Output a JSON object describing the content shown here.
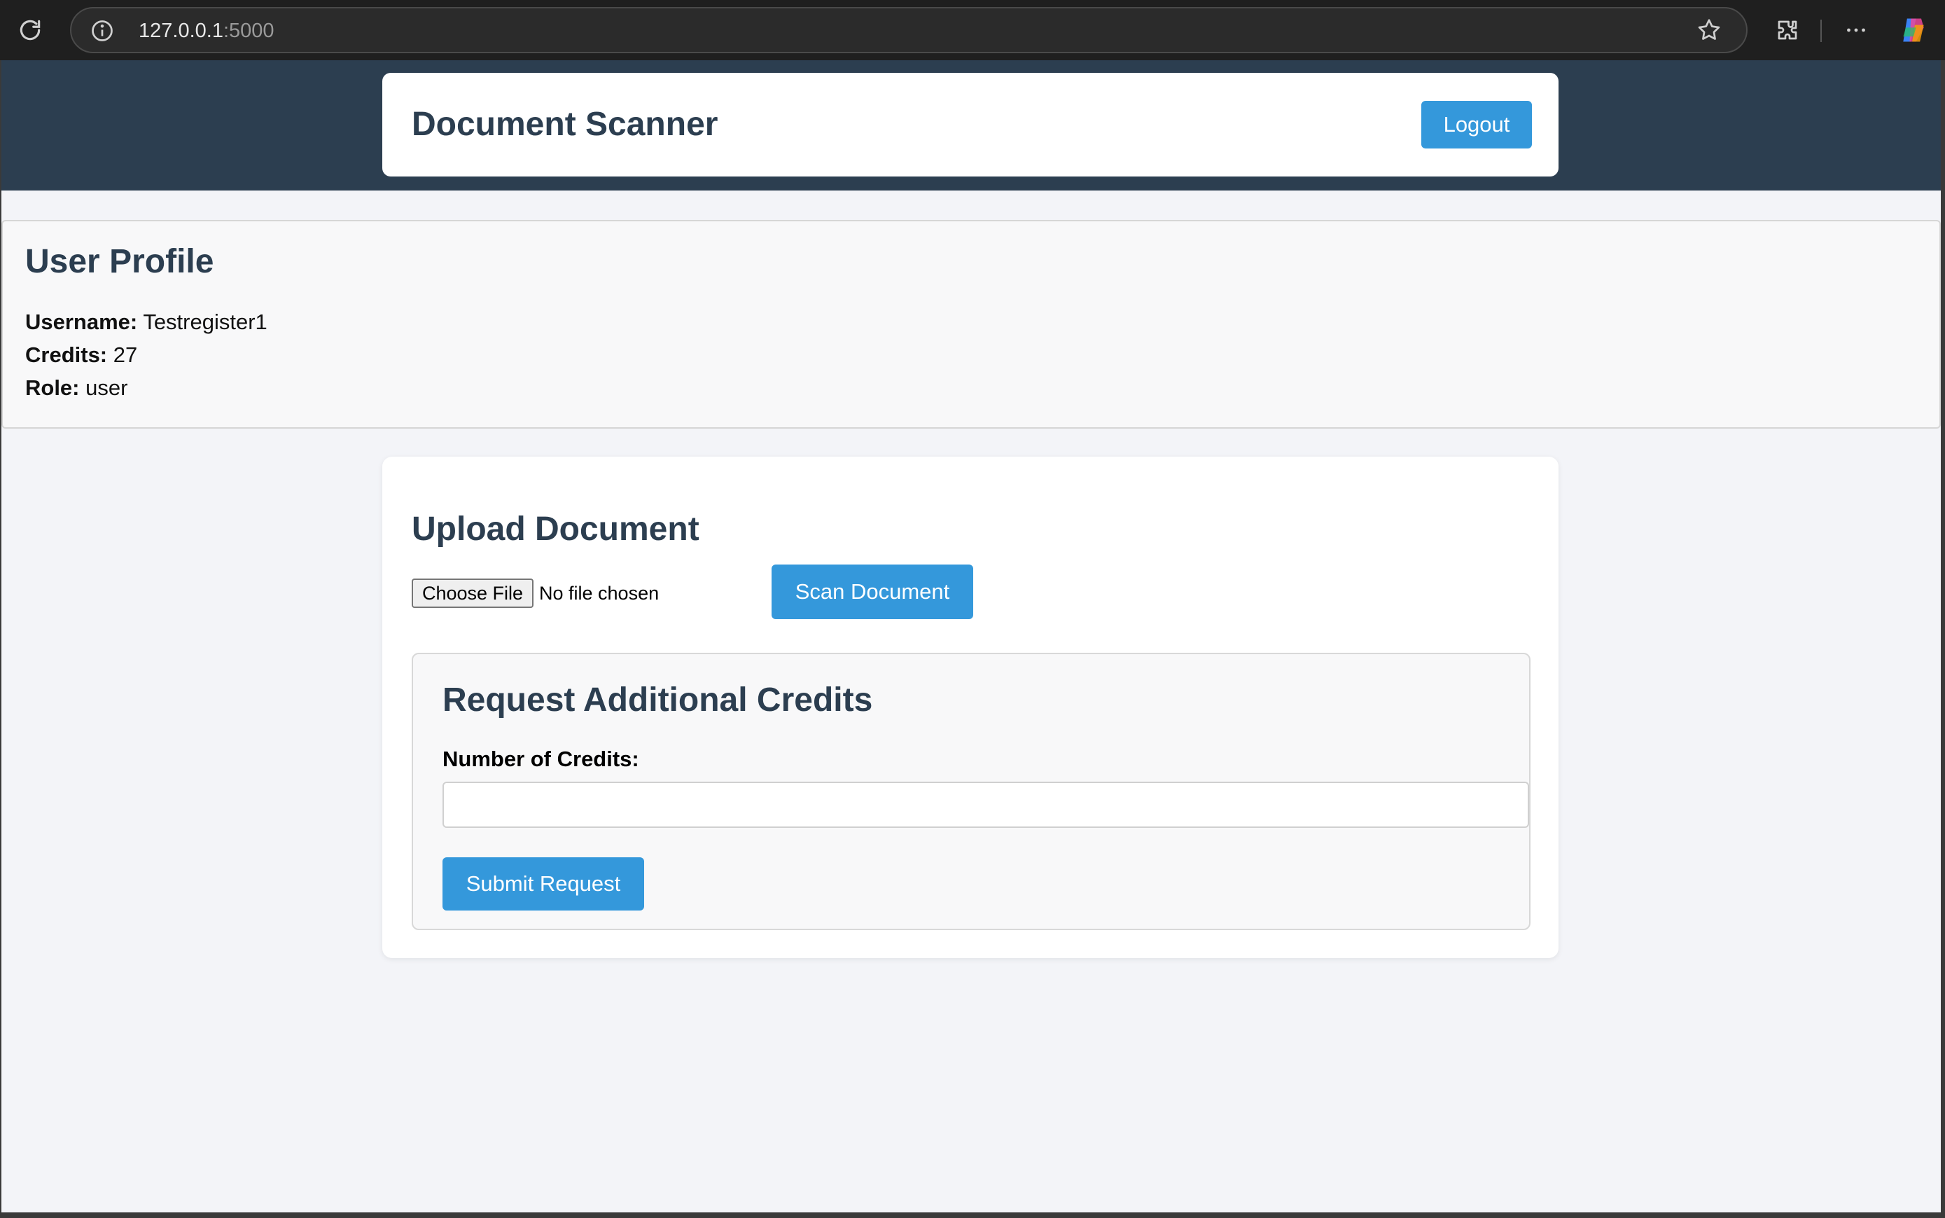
{
  "browser": {
    "url_host": "127.0.0.1",
    "url_port": ":5000"
  },
  "header": {
    "title": "Document Scanner",
    "logout_label": "Logout"
  },
  "profile": {
    "title": "User Profile",
    "username_label": "Username:",
    "username_value": "Testregister1",
    "credits_label": "Credits:",
    "credits_value": "27",
    "role_label": "Role:",
    "role_value": "user"
  },
  "upload": {
    "title": "Upload Document",
    "choose_file_label": "Choose File",
    "no_file_text": "No file chosen",
    "scan_label": "Scan Document"
  },
  "credits_request": {
    "title": "Request Additional Credits",
    "field_label": "Number of Credits:",
    "field_value": "",
    "submit_label": "Submit Request"
  },
  "colors": {
    "primary": "#3498db",
    "heading": "#2c3e50",
    "hero_bg": "#2c3e50",
    "page_bg": "#f3f4f8"
  }
}
